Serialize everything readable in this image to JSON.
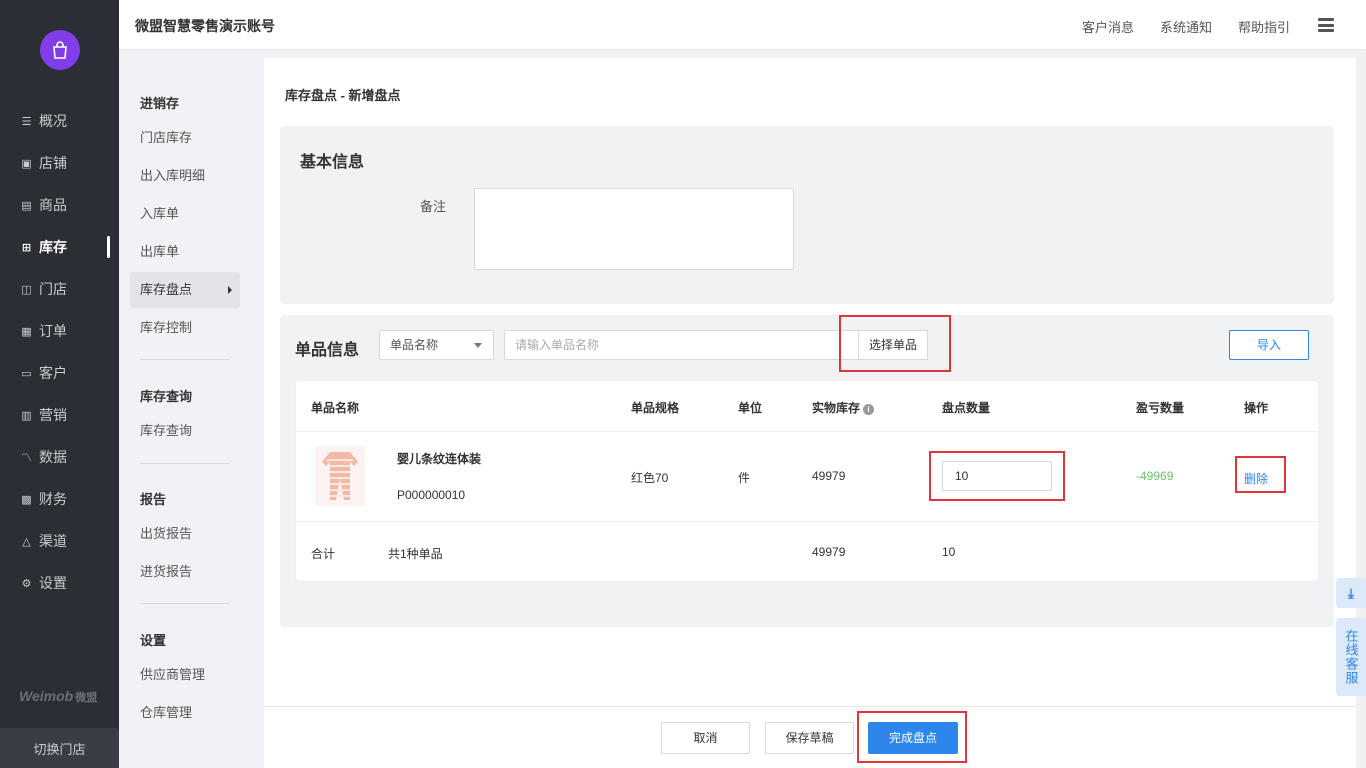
{
  "brand": {
    "name": "Weimob",
    "sub": "微盟",
    "switch_store": "切换门店"
  },
  "nav": [
    {
      "label": "概况",
      "icon": "list-icon"
    },
    {
      "label": "店铺",
      "icon": "shop-icon"
    },
    {
      "label": "商品",
      "icon": "goods-icon"
    },
    {
      "label": "库存",
      "icon": "grid-icon",
      "active": true
    },
    {
      "label": "门店",
      "icon": "store-icon"
    },
    {
      "label": "订单",
      "icon": "order-icon"
    },
    {
      "label": "客户",
      "icon": "vip-icon"
    },
    {
      "label": "营销",
      "icon": "chart-bar-icon"
    },
    {
      "label": "数据",
      "icon": "line-chart-icon"
    },
    {
      "label": "财务",
      "icon": "finance-icon"
    },
    {
      "label": "渠道",
      "icon": "channel-icon"
    },
    {
      "label": "设置",
      "icon": "gear-icon"
    }
  ],
  "header": {
    "title": "微盟智慧零售演示账号",
    "links": [
      "客户消息",
      "系统通知",
      "帮助指引"
    ]
  },
  "subnav": {
    "group1": "进销存",
    "group1_items": [
      "门店库存",
      "出入库明细",
      "入库单",
      "出库单",
      "库存盘点",
      "库存控制"
    ],
    "group2": "库存查询",
    "group2_items": [
      "库存查询"
    ],
    "group3": "报告",
    "group3_items": [
      "出货报告",
      "进货报告"
    ],
    "group4": "设置",
    "group4_items": [
      "供应商管理",
      "仓库管理"
    ]
  },
  "main": {
    "breadcrumb": "库存盘点 - 新增盘点",
    "basic": {
      "title": "基本信息",
      "remark_label": "备注",
      "remark_value": ""
    },
    "items": {
      "title": "单品信息",
      "select_value": "单品名称",
      "search_placeholder": "请输入单品名称",
      "pick_button": "选择单品",
      "import_button": "导入"
    },
    "table": {
      "headers": [
        "单品名称",
        "单品规格",
        "单位",
        "实物库存",
        "盘点数量",
        "盈亏数量",
        "操作"
      ],
      "row": {
        "name": "婴儿条纹连体装",
        "code": "P000000010",
        "spec": "红色70",
        "unit": "件",
        "stock": "49979",
        "count": "10",
        "diff": "-49969",
        "action": "删除"
      },
      "total": {
        "label": "合计",
        "summary": "共1种单品",
        "stock": "49979",
        "count": "10"
      }
    }
  },
  "footer": {
    "cancel": "取消",
    "save_draft": "保存草稿",
    "finish": "完成盘点"
  },
  "float": {
    "download_icon": "download-icon",
    "service": "在线客服"
  },
  "colors": {
    "accent": "#2d86ea",
    "nav_bg": "#2b2e35",
    "highlight": "#e0353a",
    "diff": "#6cc26c"
  }
}
